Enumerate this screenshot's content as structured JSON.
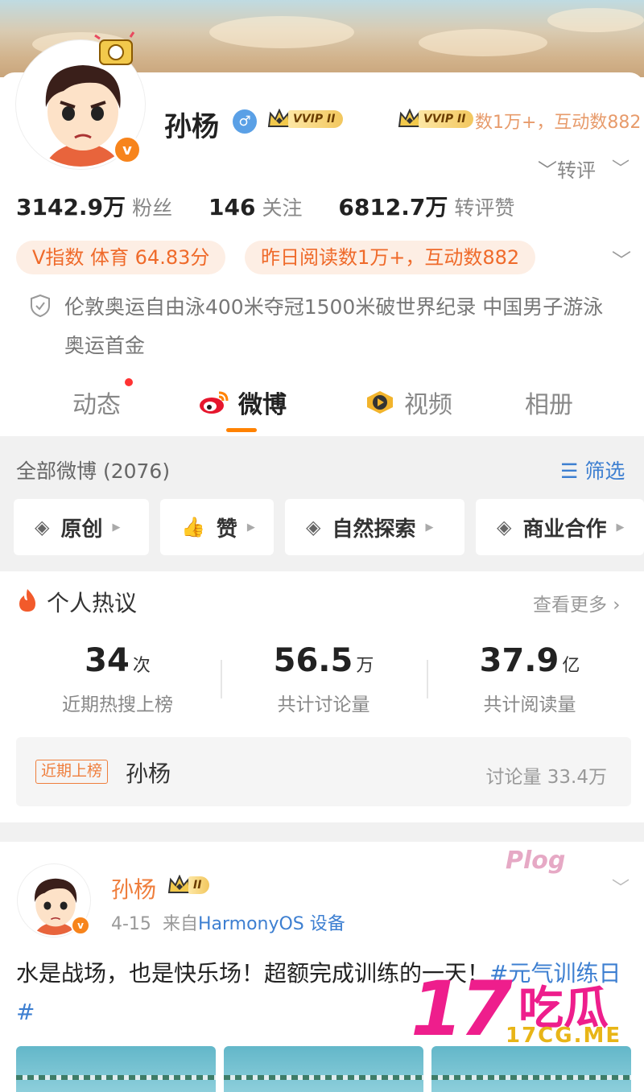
{
  "profile": {
    "name": "孙杨",
    "gender_symbol": "♂",
    "vip_label": "VVIP",
    "vip_level": "II",
    "ghost_text": "数1万+，互动数882",
    "badge_letter": "v",
    "repost_toggle": "转评",
    "chevron": "﹀"
  },
  "stats": [
    {
      "value": "3142.9万",
      "label": "粉丝"
    },
    {
      "value": "146",
      "label": "关注"
    },
    {
      "value": "6812.7万",
      "label": "转评赞"
    }
  ],
  "pills": [
    "V指数 体育 64.83分",
    "昨日阅读数1万+，互动数882"
  ],
  "bio": "伦敦奥运自由泳400米夺冠1500米破世界纪录 中国男子游泳奥运首金",
  "tabs": [
    {
      "label": "动态",
      "has_dot": true
    },
    {
      "label": "微博",
      "active": true
    },
    {
      "label": "视频"
    },
    {
      "label": "相册"
    }
  ],
  "filter": {
    "all_label": "全部微博 (2076)",
    "filter_label": "筛选",
    "chips": [
      "原创",
      "赞",
      "自然探索",
      "商业合作"
    ]
  },
  "hot": {
    "title": "个人热议",
    "more": "查看更多 ›",
    "metrics": [
      {
        "num": "34",
        "unit": "次",
        "label": "近期热搜上榜"
      },
      {
        "num": "56.5",
        "unit": "万",
        "label": "共计讨论量"
      },
      {
        "num": "37.9",
        "unit": "亿",
        "label": "共计阅读量"
      }
    ],
    "trend": {
      "tag": "近期上榜",
      "name": "孙杨",
      "count": "讨论量 33.4万"
    }
  },
  "post": {
    "author": "孙杨",
    "vip_level": "II",
    "date": "4-15",
    "from_prefix": "来自",
    "source": "HarmonyOS 设备",
    "text": "水是战场，也是快乐场！超额完成训练的一天！",
    "topic": "#元气训练日#",
    "plog": "Plog"
  },
  "watermark": {
    "big": "17",
    "cn": "吃瓜",
    "url": "17CG.ME"
  },
  "colors": {
    "accent": "#ff8200",
    "orange_text": "#ef6a2a",
    "link": "#3d7fd1",
    "verified": "#f7841c",
    "watermark": "#ee1e8c"
  }
}
